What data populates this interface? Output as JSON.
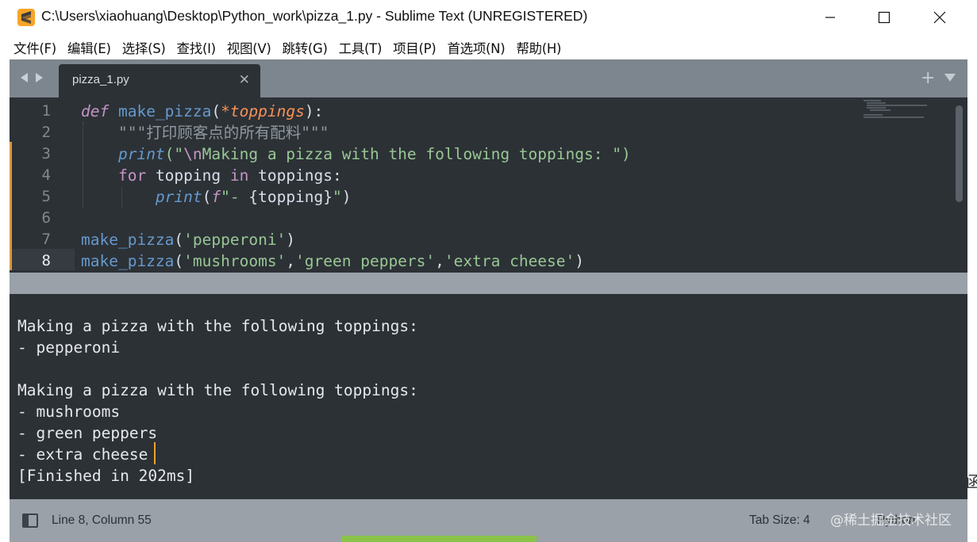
{
  "window": {
    "title": "C:\\Users\\xiaohuang\\Desktop\\Python_work\\pizza_1.py - Sublime Text (UNREGISTERED)",
    "app_icon": "sublime-text-icon"
  },
  "menu": {
    "items": [
      "文件(F)",
      "编辑(E)",
      "选择(S)",
      "查找(I)",
      "视图(V)",
      "跳转(G)",
      "工具(T)",
      "项目(P)",
      "首选项(N)",
      "帮助(H)"
    ]
  },
  "tabs": [
    {
      "label": "pizza_1.py",
      "active": true
    }
  ],
  "editor": {
    "line_numbers": [
      "1",
      "2",
      "3",
      "4",
      "5",
      "6",
      "7",
      "8"
    ],
    "active_line": 8,
    "modified_lines": [
      3,
      4,
      5,
      6,
      7,
      8
    ],
    "code": {
      "l1_def": "def",
      "l1_name": "make_pizza",
      "l1_open": "(",
      "l1_star": "*",
      "l1_param": "toppings",
      "l1_close": "):",
      "l2_doc": "\"\"\"打印顾客点的所有配料\"\"\"",
      "l3_print": "print",
      "l3_open": "(\"",
      "l3_esc": "\\n",
      "l3_str": "Making a pizza with the following toppings: ",
      "l3_close": "\")",
      "l4_for": "for",
      "l4_var": " topping ",
      "l4_in": "in",
      "l4_iter": " toppings:",
      "l5_print": "print",
      "l5_open": "(",
      "l5_f": "f",
      "l5_str": "\"- ",
      "l5_fexpr": "{topping}",
      "l5_close_str": "\"",
      "l5_close": ")",
      "l7_call": "make_pizza",
      "l7_open": "(",
      "l7_arg": "'pepperoni'",
      "l7_close": ")",
      "l8_call": "make_pizza",
      "l8_open": "(",
      "l8_arg1": "'mushrooms'",
      "l8_comma1": ",",
      "l8_arg2": "'green peppers'",
      "l8_comma2": ",",
      "l8_arg3": "'extra cheese'",
      "l8_close": ")"
    }
  },
  "output": {
    "lines": [
      "",
      "Making a pizza with the following toppings:",
      "- pepperoni",
      "",
      "Making a pizza with the following toppings:",
      "- mushrooms",
      "- green peppers",
      "- extra cheese",
      "[Finished in 202ms]"
    ]
  },
  "status": {
    "position": "Line 8, Column 55",
    "tab_size": "Tab Size: 4",
    "syntax": "Python"
  },
  "watermark": "@稀土掘金技术社区",
  "colors": {
    "background": "#2c3136",
    "tabbar": "#7d868e",
    "statusbar": "#9aa1a8",
    "keyword": "#c594c5",
    "function": "#6699cc",
    "string": "#99c794",
    "parameter": "#f99157",
    "caret": "#f0a030"
  }
}
